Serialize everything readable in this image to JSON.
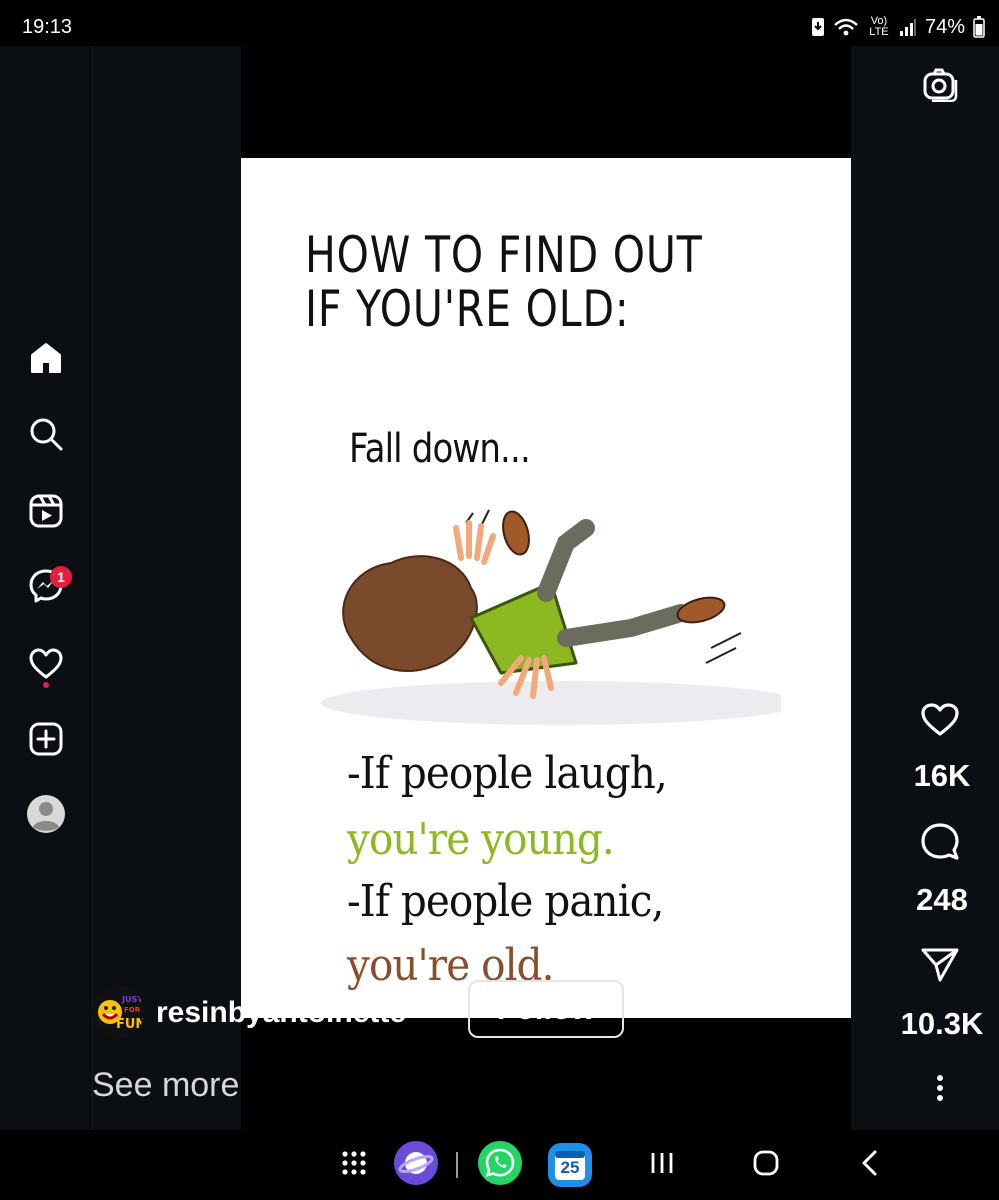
{
  "status_bar": {
    "time": "19:13",
    "network": "Vo) LTE",
    "battery": "74%"
  },
  "nav": {
    "items": [
      {
        "name": "home",
        "icon": "home-icon"
      },
      {
        "name": "search",
        "icon": "search-icon"
      },
      {
        "name": "reels",
        "icon": "reels-icon"
      },
      {
        "name": "messenger",
        "icon": "messenger-icon",
        "badge": "1"
      },
      {
        "name": "notifications",
        "icon": "heart-icon"
      },
      {
        "name": "create",
        "icon": "plus-square-icon"
      },
      {
        "name": "profile",
        "icon": "avatar-icon"
      }
    ]
  },
  "post": {
    "title_line1": "HOW TO FIND OUT",
    "title_line2": "IF YOU'RE OLD:",
    "fall": "Fall down...",
    "line1": "-If people laugh,",
    "line2": "you're young.",
    "line3": "-If people panic,",
    "line4": "you're old.",
    "colors": {
      "young": "#8cb822",
      "old": "#8a4f2a"
    }
  },
  "author": {
    "avatar_text": "JUST FOR FUN",
    "username": "resinbyantoinette",
    "follow_label": "Follow",
    "see_more": "See more"
  },
  "actions": {
    "likes": "16K",
    "comments": "248",
    "shares": "10.3K"
  },
  "system_nav": {
    "calendar_day": "25"
  }
}
